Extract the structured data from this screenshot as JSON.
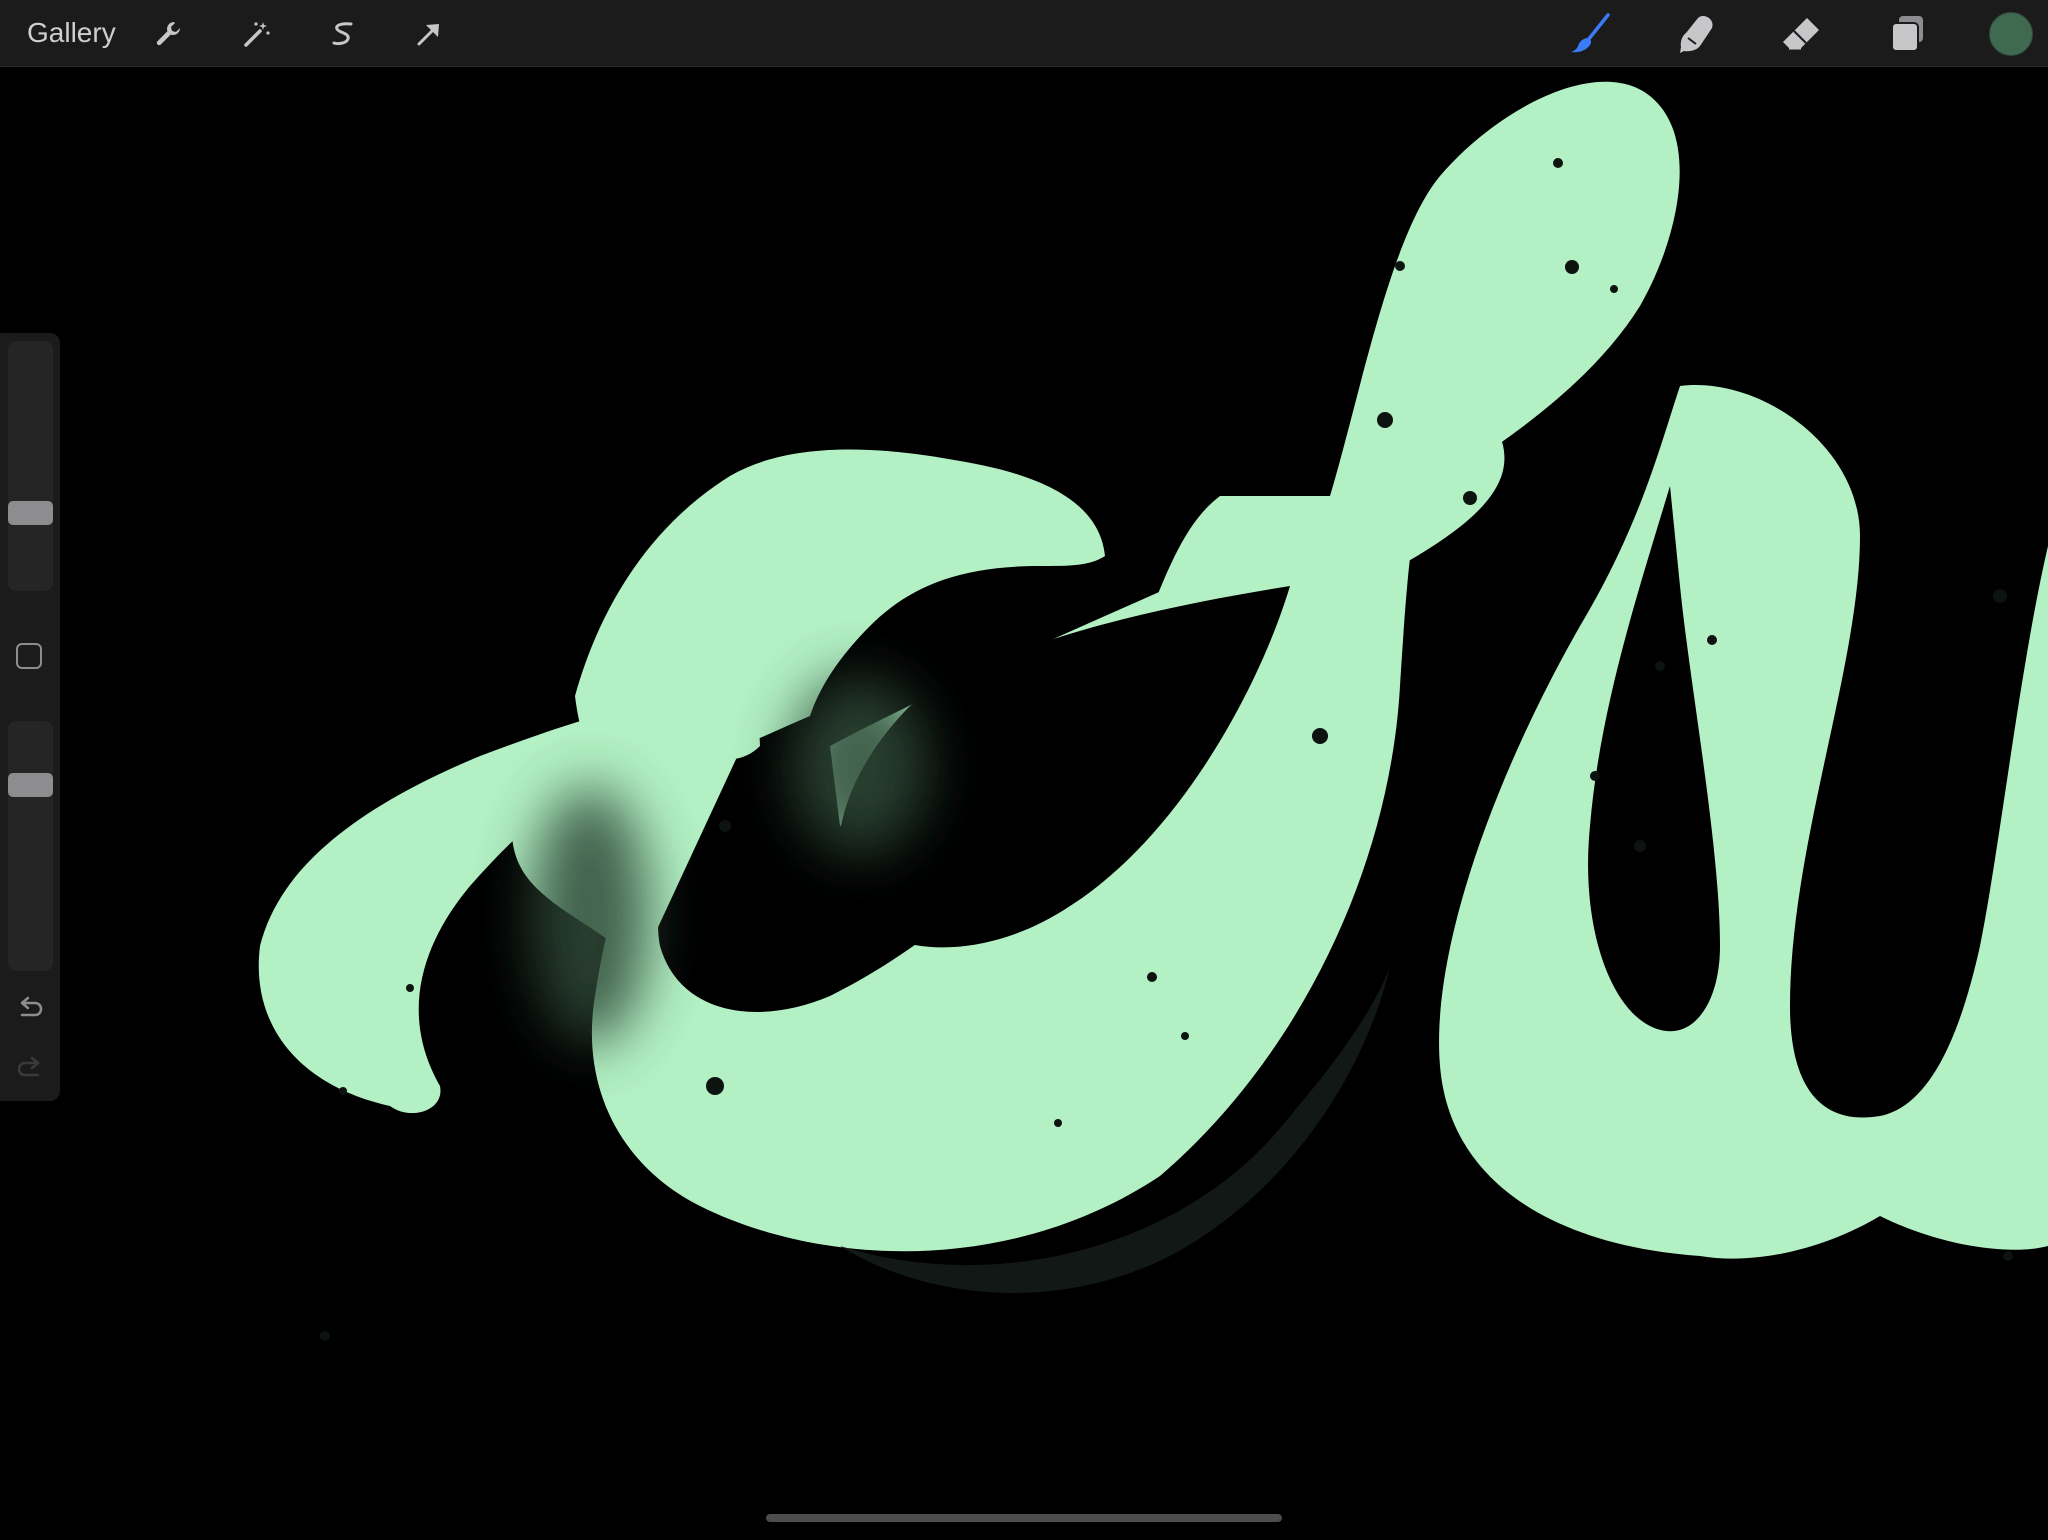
{
  "toolbar": {
    "gallery_label": "Gallery",
    "tools": [
      {
        "name": "actions",
        "icon": "wrench-icon",
        "active": false
      },
      {
        "name": "adjustments",
        "icon": "magic-wand-icon",
        "active": false
      },
      {
        "name": "selection",
        "icon": "selection-s-icon",
        "active": false
      },
      {
        "name": "transform",
        "icon": "arrow-cursor-icon",
        "active": false
      },
      {
        "name": "brush",
        "icon": "brush-icon",
        "active": true
      },
      {
        "name": "smudge",
        "icon": "smudge-finger-icon",
        "active": false
      },
      {
        "name": "eraser",
        "icon": "eraser-icon",
        "active": false
      },
      {
        "name": "layers",
        "icon": "layers-icon",
        "active": false
      }
    ],
    "active_color": "#3f6a4f",
    "accent_color": "#3b7bf5"
  },
  "sidebar": {
    "brush_size_level": 0.29,
    "brush_opacity_level": 0.77
  },
  "canvas": {
    "background_color": "#000000",
    "lettering_color": "#b3f0c4",
    "shadow_color": "#3a5a45"
  }
}
